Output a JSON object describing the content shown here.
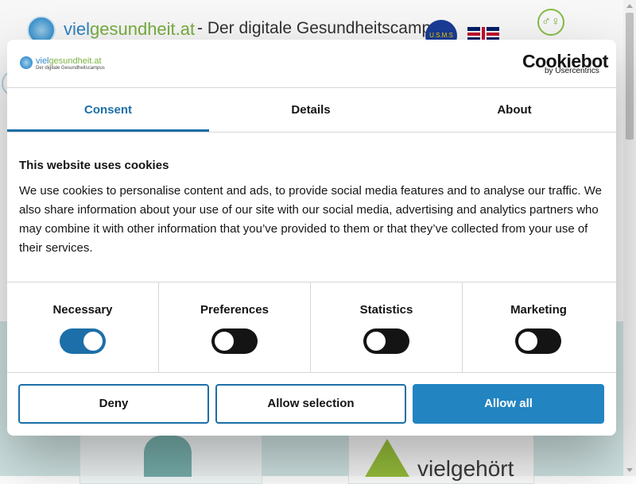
{
  "site": {
    "brand_part1": "viel",
    "brand_part2": "gesundheit.at",
    "tagline": "- Der digitale Gesundheitscampus",
    "eu_badge_text": "U.S.M.S",
    "card_right_text": "vielgehört"
  },
  "dialog": {
    "logo": {
      "brand_part1": "viel",
      "brand_part2": "gesundheit.at",
      "tagline": "Der digitale Gesundheitscampus"
    },
    "cookiebot": {
      "name": "Cookiebot",
      "by": "by Usercentrics"
    },
    "tabs": [
      {
        "label": "Consent",
        "active": true
      },
      {
        "label": "Details",
        "active": false
      },
      {
        "label": "About",
        "active": false
      }
    ],
    "heading": "This website uses cookies",
    "body": "We use cookies to personalise content and ads, to provide social media features and to analyse our traffic. We also share information about your use of our site with our social media, advertising and analytics partners who may combine it with other information that you’ve provided to them or that they’ve collected from your use of their services.",
    "toggles": [
      {
        "label": "Necessary",
        "checked": true
      },
      {
        "label": "Preferences",
        "checked": false
      },
      {
        "label": "Statistics",
        "checked": false
      },
      {
        "label": "Marketing",
        "checked": false
      }
    ],
    "buttons": {
      "deny": "Deny",
      "allow_selection": "Allow selection",
      "allow_all": "Allow all"
    }
  },
  "colors": {
    "accent": "#1c6fa8",
    "primary_button": "#2284c0",
    "brand_green": "#7cb342",
    "brand_blue": "#2f86c7"
  }
}
